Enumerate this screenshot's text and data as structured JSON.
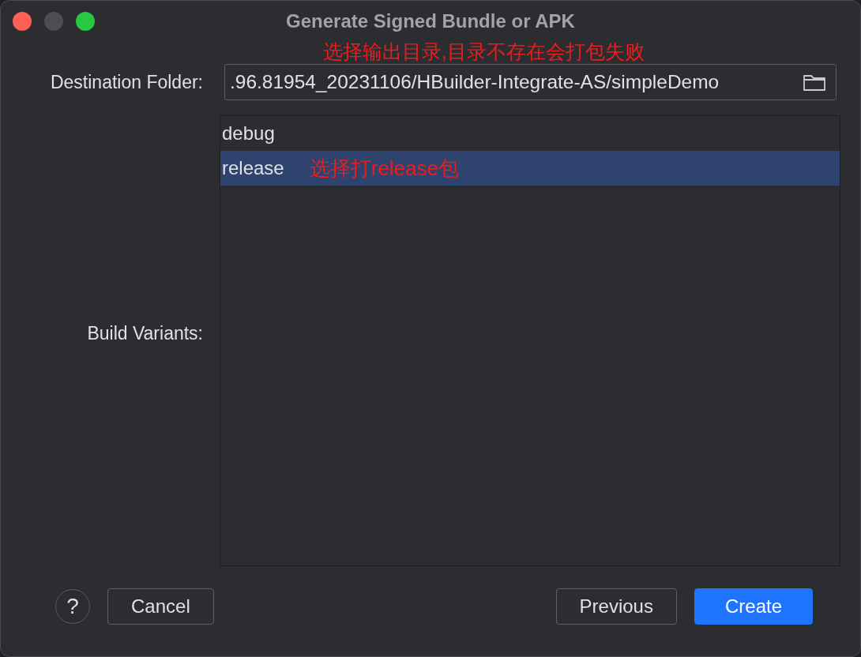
{
  "window": {
    "title": "Generate Signed Bundle or APK"
  },
  "destination_folder": {
    "label": "Destination Folder:",
    "value": ".96.81954_20231106/HBuilder-Integrate-AS/simpleDemo"
  },
  "build_variants": {
    "label": "Build Variants:",
    "items": [
      {
        "label": "debug",
        "selected": false
      },
      {
        "label": "release",
        "selected": true,
        "annotation": "选择打release包"
      }
    ]
  },
  "annotation": "选择输出目录,目录不存在会打包失败",
  "buttons": [
    {
      "label": "Cancel",
      "kind": "secondary"
    },
    {
      "label": "Previous",
      "kind": "secondary"
    },
    {
      "label": "Create",
      "kind": "primary"
    }
  ],
  "help_button": {
    "label": "?"
  }
}
